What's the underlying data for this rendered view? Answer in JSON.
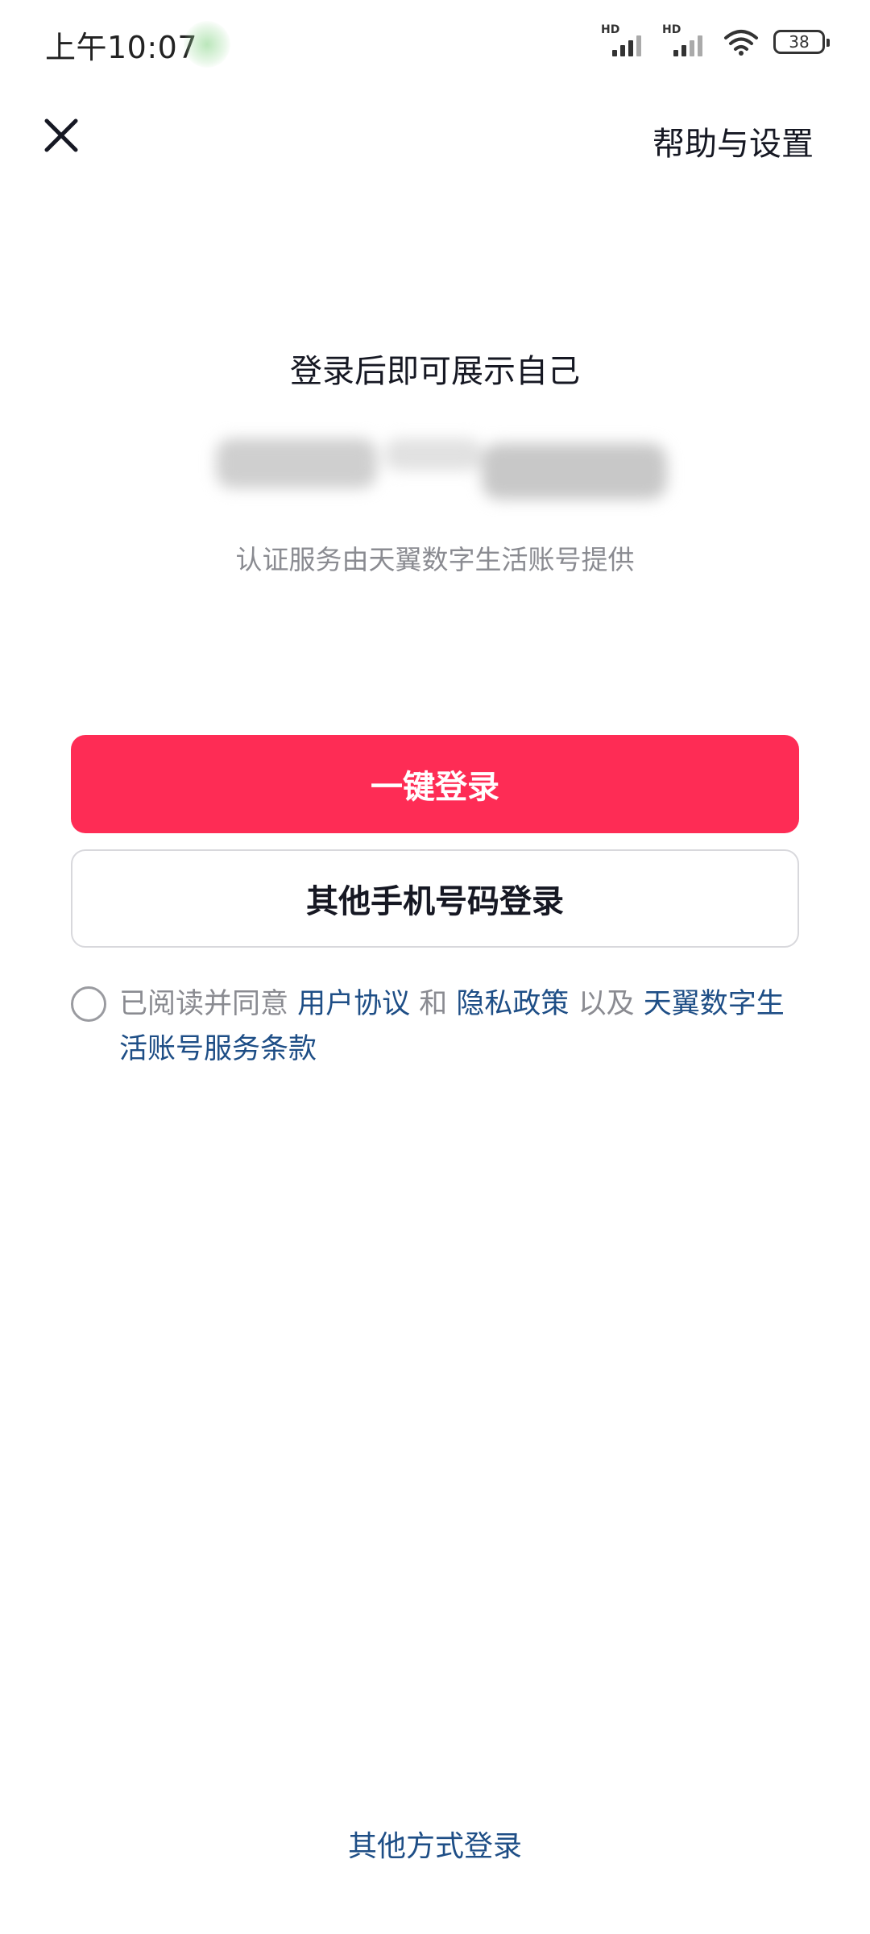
{
  "status_bar": {
    "time": "上午10:07",
    "signal1_label": "HD",
    "signal2_label": "HD",
    "battery": "38"
  },
  "header": {
    "close_icon": "close-icon",
    "help_label": "帮助与设置"
  },
  "main": {
    "headline": "登录后即可展示自己",
    "provider_text": "认证服务由天翼数字生活账号提供",
    "one_click_label": "一键登录",
    "other_phone_label": "其他手机号码登录"
  },
  "agreement": {
    "prefix": "已阅读并同意 ",
    "user_agreement": "用户协议",
    "and": " 和 ",
    "privacy_policy": "隐私政策",
    "also": " 以及 ",
    "service_terms": "天翼数字生活账号服务条款"
  },
  "footer": {
    "other_methods_label": "其他方式登录"
  },
  "colors": {
    "primary": "#fe2c55",
    "link": "#1e4e86",
    "muted": "#8a8b91"
  }
}
